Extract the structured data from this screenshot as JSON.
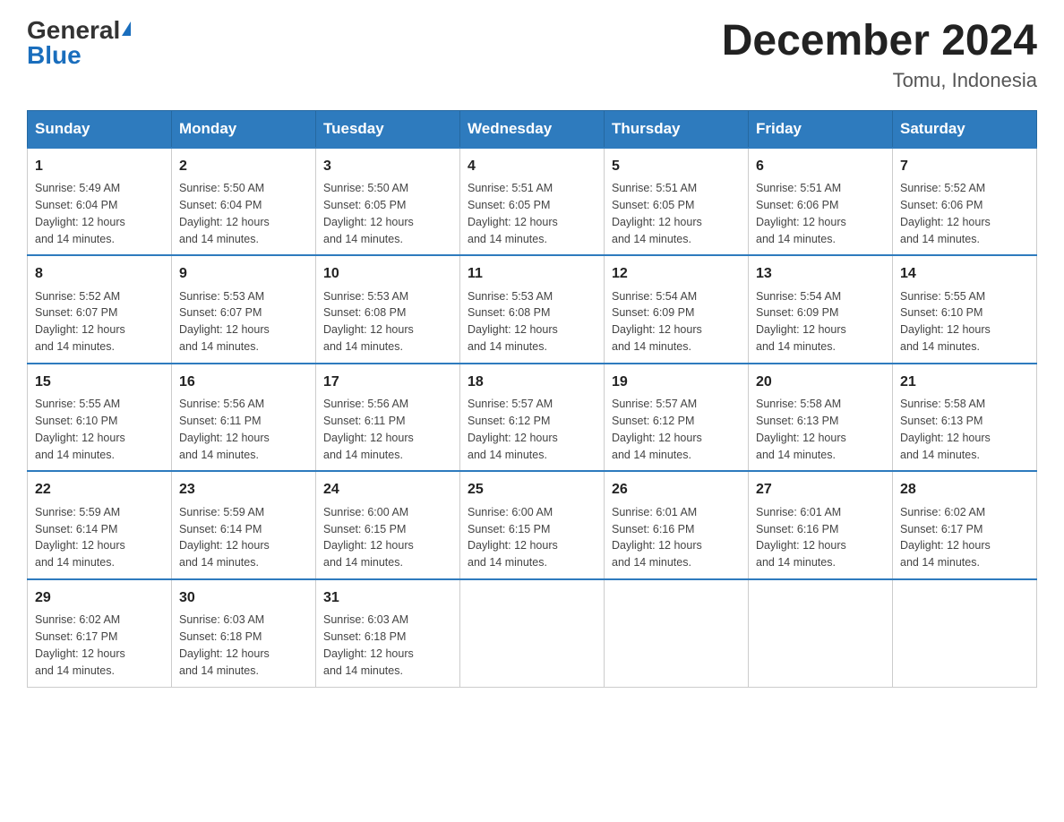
{
  "header": {
    "logo_general": "General",
    "logo_blue": "Blue",
    "month_title": "December 2024",
    "location": "Tomu, Indonesia"
  },
  "days_of_week": [
    "Sunday",
    "Monday",
    "Tuesday",
    "Wednesday",
    "Thursday",
    "Friday",
    "Saturday"
  ],
  "weeks": [
    [
      {
        "day": "1",
        "sunrise": "5:49 AM",
        "sunset": "6:04 PM",
        "daylight": "12 hours and 14 minutes."
      },
      {
        "day": "2",
        "sunrise": "5:50 AM",
        "sunset": "6:04 PM",
        "daylight": "12 hours and 14 minutes."
      },
      {
        "day": "3",
        "sunrise": "5:50 AM",
        "sunset": "6:05 PM",
        "daylight": "12 hours and 14 minutes."
      },
      {
        "day": "4",
        "sunrise": "5:51 AM",
        "sunset": "6:05 PM",
        "daylight": "12 hours and 14 minutes."
      },
      {
        "day": "5",
        "sunrise": "5:51 AM",
        "sunset": "6:05 PM",
        "daylight": "12 hours and 14 minutes."
      },
      {
        "day": "6",
        "sunrise": "5:51 AM",
        "sunset": "6:06 PM",
        "daylight": "12 hours and 14 minutes."
      },
      {
        "day": "7",
        "sunrise": "5:52 AM",
        "sunset": "6:06 PM",
        "daylight": "12 hours and 14 minutes."
      }
    ],
    [
      {
        "day": "8",
        "sunrise": "5:52 AM",
        "sunset": "6:07 PM",
        "daylight": "12 hours and 14 minutes."
      },
      {
        "day": "9",
        "sunrise": "5:53 AM",
        "sunset": "6:07 PM",
        "daylight": "12 hours and 14 minutes."
      },
      {
        "day": "10",
        "sunrise": "5:53 AM",
        "sunset": "6:08 PM",
        "daylight": "12 hours and 14 minutes."
      },
      {
        "day": "11",
        "sunrise": "5:53 AM",
        "sunset": "6:08 PM",
        "daylight": "12 hours and 14 minutes."
      },
      {
        "day": "12",
        "sunrise": "5:54 AM",
        "sunset": "6:09 PM",
        "daylight": "12 hours and 14 minutes."
      },
      {
        "day": "13",
        "sunrise": "5:54 AM",
        "sunset": "6:09 PM",
        "daylight": "12 hours and 14 minutes."
      },
      {
        "day": "14",
        "sunrise": "5:55 AM",
        "sunset": "6:10 PM",
        "daylight": "12 hours and 14 minutes."
      }
    ],
    [
      {
        "day": "15",
        "sunrise": "5:55 AM",
        "sunset": "6:10 PM",
        "daylight": "12 hours and 14 minutes."
      },
      {
        "day": "16",
        "sunrise": "5:56 AM",
        "sunset": "6:11 PM",
        "daylight": "12 hours and 14 minutes."
      },
      {
        "day": "17",
        "sunrise": "5:56 AM",
        "sunset": "6:11 PM",
        "daylight": "12 hours and 14 minutes."
      },
      {
        "day": "18",
        "sunrise": "5:57 AM",
        "sunset": "6:12 PM",
        "daylight": "12 hours and 14 minutes."
      },
      {
        "day": "19",
        "sunrise": "5:57 AM",
        "sunset": "6:12 PM",
        "daylight": "12 hours and 14 minutes."
      },
      {
        "day": "20",
        "sunrise": "5:58 AM",
        "sunset": "6:13 PM",
        "daylight": "12 hours and 14 minutes."
      },
      {
        "day": "21",
        "sunrise": "5:58 AM",
        "sunset": "6:13 PM",
        "daylight": "12 hours and 14 minutes."
      }
    ],
    [
      {
        "day": "22",
        "sunrise": "5:59 AM",
        "sunset": "6:14 PM",
        "daylight": "12 hours and 14 minutes."
      },
      {
        "day": "23",
        "sunrise": "5:59 AM",
        "sunset": "6:14 PM",
        "daylight": "12 hours and 14 minutes."
      },
      {
        "day": "24",
        "sunrise": "6:00 AM",
        "sunset": "6:15 PM",
        "daylight": "12 hours and 14 minutes."
      },
      {
        "day": "25",
        "sunrise": "6:00 AM",
        "sunset": "6:15 PM",
        "daylight": "12 hours and 14 minutes."
      },
      {
        "day": "26",
        "sunrise": "6:01 AM",
        "sunset": "6:16 PM",
        "daylight": "12 hours and 14 minutes."
      },
      {
        "day": "27",
        "sunrise": "6:01 AM",
        "sunset": "6:16 PM",
        "daylight": "12 hours and 14 minutes."
      },
      {
        "day": "28",
        "sunrise": "6:02 AM",
        "sunset": "6:17 PM",
        "daylight": "12 hours and 14 minutes."
      }
    ],
    [
      {
        "day": "29",
        "sunrise": "6:02 AM",
        "sunset": "6:17 PM",
        "daylight": "12 hours and 14 minutes."
      },
      {
        "day": "30",
        "sunrise": "6:03 AM",
        "sunset": "6:18 PM",
        "daylight": "12 hours and 14 minutes."
      },
      {
        "day": "31",
        "sunrise": "6:03 AM",
        "sunset": "6:18 PM",
        "daylight": "12 hours and 14 minutes."
      },
      null,
      null,
      null,
      null
    ]
  ],
  "labels": {
    "sunrise": "Sunrise:",
    "sunset": "Sunset:",
    "daylight": "Daylight:"
  }
}
